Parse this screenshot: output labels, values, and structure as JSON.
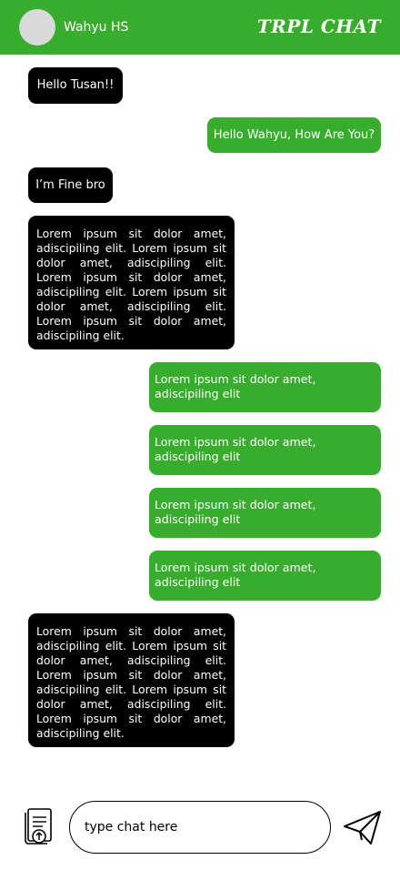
{
  "header": {
    "contact_name": "Wahyu HS",
    "app_title": "TRPL CHAT"
  },
  "messages": [
    {
      "direction": "incoming",
      "text": "Hello Tusan!!"
    },
    {
      "direction": "outgoing",
      "text": "Hello Wahyu, How Are You?"
    },
    {
      "direction": "incoming",
      "text": "I’m Fine bro"
    },
    {
      "direction": "incoming",
      "text": "Lorem ipsum sit dolor amet, adiscipiling elit. Lorem ipsum sit dolor amet, adiscipiling elit. Lorem ipsum sit dolor amet, adiscipiling elit. Lorem ipsum sit dolor amet, adiscipiling elit. Lorem ipsum sit dolor amet, adiscipiling elit."
    },
    {
      "direction": "outgoing",
      "text": "Lorem ipsum sit dolor amet, adiscipiling elit"
    },
    {
      "direction": "outgoing",
      "text": "Lorem ipsum sit dolor amet, adiscipiling elit"
    },
    {
      "direction": "outgoing",
      "text": "Lorem ipsum sit dolor amet, adiscipiling elit"
    },
    {
      "direction": "outgoing",
      "text": "Lorem ipsum sit dolor amet, adiscipiling elit"
    },
    {
      "direction": "incoming",
      "text": "Lorem ipsum sit dolor amet, adiscipiling elit. Lorem ipsum sit dolor amet, adiscipiling elit. Lorem ipsum sit dolor amet, adiscipiling elit. Lorem ipsum sit dolor amet, adiscipiling elit. Lorem ipsum sit dolor amet, adiscipiling elit."
    }
  ],
  "composer": {
    "placeholder": "type chat here",
    "attach_icon": "file-upload-icon",
    "send_icon": "paper-plane-icon"
  },
  "colors": {
    "primary": "#38ac2c",
    "incoming_bubble": "#000000",
    "outgoing_bubble": "#38ac2c",
    "text_on_bubble": "#ffffff"
  }
}
